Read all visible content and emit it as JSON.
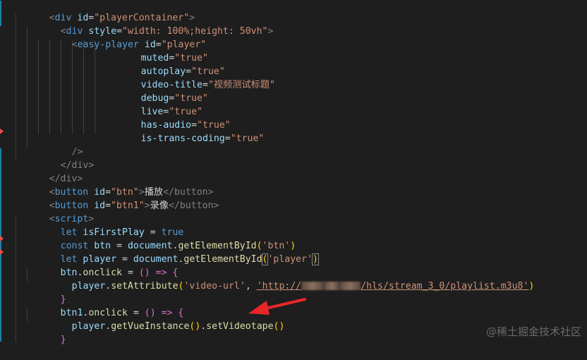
{
  "code": {
    "l01": {
      "open": "<",
      "tag": "div",
      "attr": "id",
      "eq": "=",
      "val": "\"playerContainer\"",
      "close": ">"
    },
    "l02": {
      "open": "<",
      "tag": "div",
      "attr": "style",
      "eq": "=",
      "val": "\"width: 100%;height: 50vh\"",
      "close": ">"
    },
    "l03": {
      "open": "<",
      "tag": "easy-player",
      "attr": "id",
      "eq": "=",
      "val": "\"player\""
    },
    "l04": {
      "attr": "muted",
      "eq": "=",
      "val": "\"true\""
    },
    "l05": {
      "attr": "autoplay",
      "eq": "=",
      "val": "\"true\""
    },
    "l06": {
      "attr": "video-title",
      "eq": "=",
      "val": "\"视频测试标题\""
    },
    "l07": {
      "attr": "debug",
      "eq": "=",
      "val": "\"true\""
    },
    "l08": {
      "attr": "live",
      "eq": "=",
      "val": "\"true\""
    },
    "l09": {
      "attr": "has-audio",
      "eq": "=",
      "val": "\"true\""
    },
    "l10": {
      "attr": "is-trans-coding",
      "eq": "=",
      "val": "\"true\""
    },
    "l11": {
      "close": "/>"
    },
    "l12": {
      "text": "</div>"
    },
    "l13": {
      "text": "</div>"
    },
    "l14": {
      "open": "<",
      "tag": "button",
      "attr": "id",
      "eq": "=",
      "val": "\"btn\"",
      "close": ">",
      "content": "播放",
      "endtag": "</button>"
    },
    "l15": {
      "open": "<",
      "tag": "button",
      "attr": "id",
      "eq": "=",
      "val": "\"btn1\"",
      "close": ">",
      "content": "录像",
      "endtag": "</button>"
    },
    "l16": {
      "open": "<",
      "tag": "script",
      "close": ">"
    },
    "l17": {
      "kw": "let",
      "var": "isFirstPlay",
      "op": " = ",
      "lit": "true"
    },
    "l18": {
      "kw": "const",
      "var": "btn",
      "op": " = ",
      "obj": "document",
      "fn": "getElementById",
      "arg": "'btn'"
    },
    "l19": {
      "kw": "let",
      "var": "player",
      "op": " = ",
      "obj": "document",
      "fn": "getElementById",
      "arg": "'player'"
    },
    "l20": {
      "var": "btn",
      "prop": "onclick",
      "op": " = ",
      "arrow": "() => {"
    },
    "l21": {
      "obj": "player",
      "fn": "setAttribute",
      "arg1": "'video-url'",
      "url_a": "'http://",
      "url_b": "/hls/stream_3_0/playlist.m3u8'"
    },
    "l22": {
      "brace": "}"
    },
    "l23": {
      "var": "btn1",
      "prop": "onclick",
      "op": " = ",
      "arrow": "() => {"
    },
    "l24": {
      "obj": "player",
      "fn1": "getVueInstance",
      "fn2": "setVideotape",
      "paren": "()"
    },
    "l25": {
      "brace": "}"
    }
  },
  "watermark": "@稀土掘金技术社区",
  "colors": {
    "background": "#1e1e1e",
    "tag": "#569cd6",
    "attribute": "#9cdcfe",
    "string": "#ce9178",
    "function": "#dcdcaa",
    "arrow_annotation": "#e8262a"
  }
}
